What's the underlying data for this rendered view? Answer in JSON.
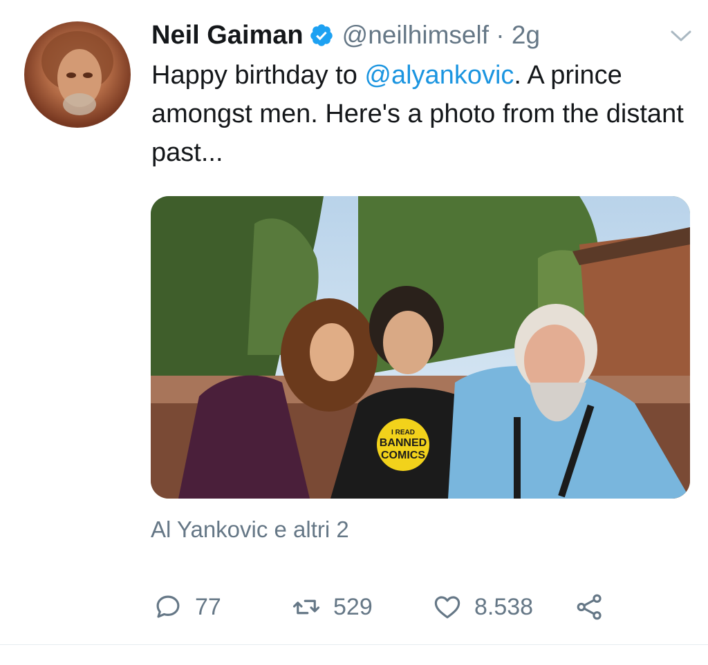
{
  "tweet": {
    "author_name": "Neil Gaiman",
    "handle_time": "@neilhimself · 2g",
    "text_before": "Happy birthday to ",
    "mention": "@alyankovic",
    "text_after": ". A prince amongst men. Here's a photo from the distant past...",
    "photo_shirt_line1": "I READ",
    "photo_shirt_line2": "BANNED",
    "photo_shirt_line3": "COMICS",
    "tagged": "Al Yankovic e altri 2"
  },
  "actions": {
    "replies": "77",
    "retweets": "529",
    "likes": "8.538"
  },
  "colors": {
    "text": "#14171a",
    "secondary": "#657786",
    "link": "#1b95e0",
    "verified": "#1da1f2"
  },
  "icons": {
    "verified": "verified-badge-icon",
    "menu": "chevron-down-icon",
    "reply": "reply-icon",
    "retweet": "retweet-icon",
    "like": "heart-icon",
    "share": "share-icon"
  }
}
